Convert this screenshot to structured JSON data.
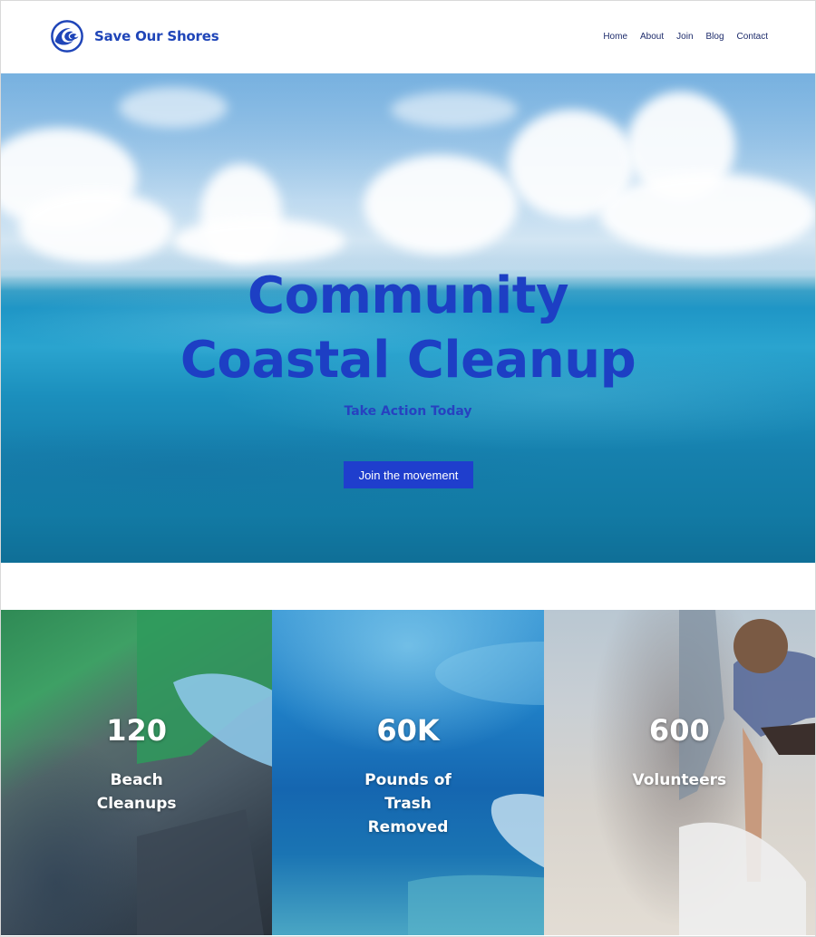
{
  "brand": {
    "name": "Save Our Shores",
    "logo_icon": "wave-circle-icon",
    "color": "#1f45b8"
  },
  "nav": {
    "items": [
      {
        "label": "Home"
      },
      {
        "label": "About"
      },
      {
        "label": "Join"
      },
      {
        "label": "Blog"
      },
      {
        "label": "Contact"
      }
    ]
  },
  "hero": {
    "title_line1": "Community",
    "title_line2": "Coastal Cleanup",
    "subtitle": "Take Action Today",
    "cta_label": "Join the movement",
    "accent_color": "#1f3ecd"
  },
  "stats": [
    {
      "value": "120",
      "label": "Beach Cleanups"
    },
    {
      "value": "60K",
      "label": "Pounds of Trash Removed"
    },
    {
      "value": "600",
      "label": "Volunteers"
    }
  ]
}
